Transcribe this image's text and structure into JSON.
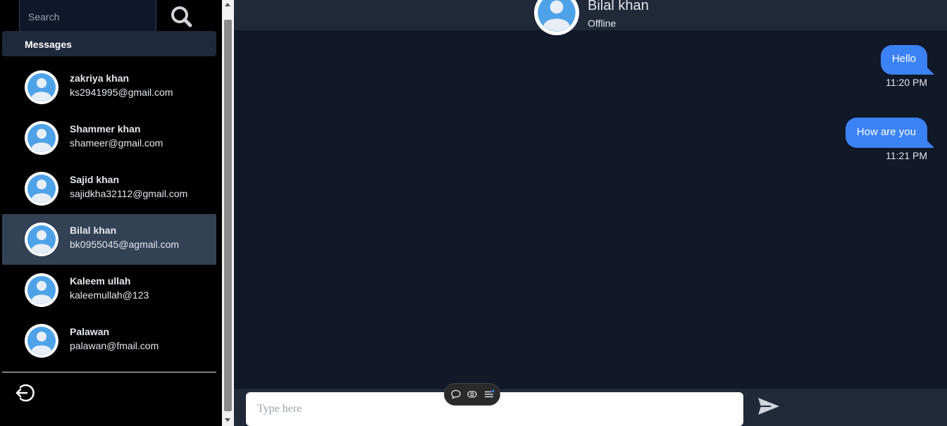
{
  "search": {
    "placeholder": "Search"
  },
  "sidebar": {
    "tab_label": "Messages",
    "contacts": [
      {
        "name": "zakriya khan",
        "email": "ks2941995@gmail.com",
        "active": false
      },
      {
        "name": "Shammer khan",
        "email": "shameer@gmail.com",
        "active": false
      },
      {
        "name": "Sajid khan",
        "email": "sajidkha32112@gmail.com",
        "active": false
      },
      {
        "name": "Bilal khan",
        "email": "bk0955045@agmail.com",
        "active": true
      },
      {
        "name": "Kaleem ullah",
        "email": "kaleemullah@123",
        "active": false
      },
      {
        "name": "Palawan",
        "email": "palawan@fmail.com",
        "active": false
      }
    ]
  },
  "chat": {
    "header": {
      "name": "Bilal khan",
      "status": "Offline"
    },
    "messages": [
      {
        "text": "Hello",
        "time": "11:20 PM"
      },
      {
        "text": "How are you",
        "time": "11:21 PM"
      }
    ],
    "composer": {
      "placeholder": "Type here"
    }
  },
  "icons": {
    "search": "search-icon",
    "logout": "logout-icon",
    "send": "send-icon",
    "avatar": "user-avatar-icon",
    "toolbar": [
      "chat-bubble-icon",
      "eye-icon",
      "list-icon"
    ]
  },
  "colors": {
    "sidebar_bg": "#000000",
    "active_contact_bg": "#334155",
    "chat_bg": "#111827",
    "header_bg": "#1f2937",
    "bubble": "#3b82f6"
  }
}
